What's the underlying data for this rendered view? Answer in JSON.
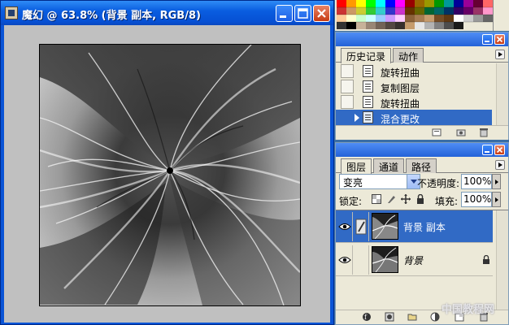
{
  "document_window": {
    "title": "魔幻 @ 63.8% (背景 副本, RGB/8)",
    "buttons": [
      "minimize",
      "maximize",
      "close"
    ],
    "background": "#c0c0c0"
  },
  "history_panel": {
    "tabs": [
      {
        "label": "历史记录",
        "active": true
      },
      {
        "label": "动作",
        "active": false
      }
    ],
    "items": [
      {
        "label": "旋转扭曲",
        "selected": false
      },
      {
        "label": "复制图层",
        "selected": false
      },
      {
        "label": "旋转扭曲",
        "selected": false
      },
      {
        "label": "混合更改",
        "selected": true
      }
    ]
  },
  "layers_panel": {
    "tabs": [
      {
        "label": "图层",
        "active": true
      },
      {
        "label": "通道",
        "active": false
      },
      {
        "label": "路径",
        "active": false
      }
    ],
    "blend_mode": "变亮",
    "opacity_label": "不透明度:",
    "opacity_value": "100%",
    "lock_label": "锁定:",
    "fill_label": "填充:",
    "fill_value": "100%",
    "layers": [
      {
        "name": "背景 副本",
        "selected": true,
        "visible": true,
        "italic": false
      },
      {
        "name": "背景",
        "selected": false,
        "visible": true,
        "italic": true,
        "locked": true
      }
    ]
  },
  "watermark": "中国教程网",
  "colors": {
    "selection": "#316ac5",
    "panel_bg": "#ece9d8",
    "xp_title": "#0a54d6"
  }
}
